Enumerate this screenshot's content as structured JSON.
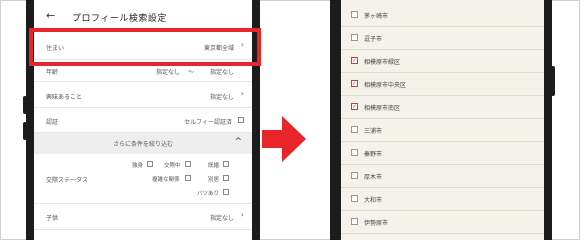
{
  "left_screen": {
    "header": {
      "back_icon": "←",
      "title": "プロフィール検索設定"
    },
    "rows": [
      {
        "label": "住まい",
        "value": "東京都全域",
        "chevron": "›"
      },
      {
        "label": "年齢",
        "value_from": "指定なし",
        "value_to": "指定なし",
        "separator": "〜"
      },
      {
        "label": "興味あること",
        "value": "指定なし",
        "chevron": "›"
      },
      {
        "label": "認証",
        "value": "セルフィー認証済"
      },
      {
        "label": "交際ステータス"
      },
      {
        "label": "子供",
        "value": "指定なし",
        "chevron": "›"
      }
    ],
    "section_toggle": {
      "label": "さらに条件を絞り込む",
      "icon": "^"
    },
    "relationship_options": [
      "独身",
      "交際中",
      "既婚",
      "複雑な関係",
      "別居",
      "バツあり"
    ]
  },
  "right_screen": {
    "cities": [
      {
        "name": "茅ヶ崎市",
        "checked": false
      },
      {
        "name": "逗子市",
        "checked": false
      },
      {
        "name": "相模原市緑区",
        "checked": true
      },
      {
        "name": "相模原市中央区",
        "checked": true
      },
      {
        "name": "相模原市南区",
        "checked": true
      },
      {
        "name": "三浦市",
        "checked": false
      },
      {
        "name": "秦野市",
        "checked": false
      },
      {
        "name": "厚木市",
        "checked": false
      },
      {
        "name": "大和市",
        "checked": false
      },
      {
        "name": "伊勢原市",
        "checked": false
      }
    ],
    "check_mark": "✓"
  },
  "colors": {
    "highlight": "#e8252b",
    "arrow": "#e8252b",
    "check": "#d73a3a"
  }
}
